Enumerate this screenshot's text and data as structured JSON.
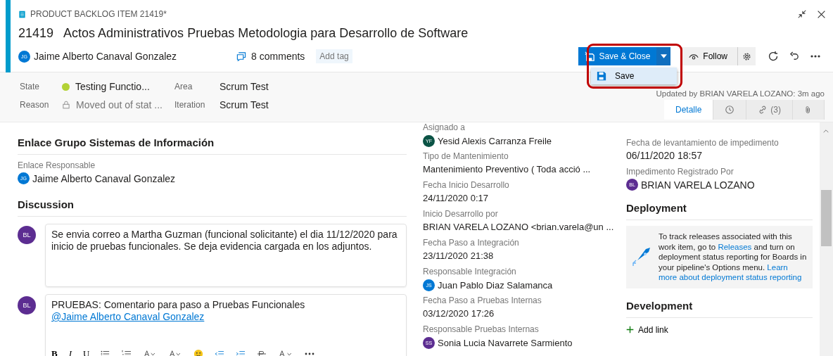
{
  "header": {
    "item_type": "PRODUCT BACKLOG ITEM 21419*",
    "id": "21419",
    "title": "Actos Administrativos Pruebas Metodologia para Desarrollo de Software",
    "assignee": {
      "initials": "JG",
      "name": "Jaime Alberto Canaval Gonzalez",
      "color": "#0078d4"
    },
    "comments": "8 comments",
    "add_tag": "Add tag"
  },
  "toolbar": {
    "save_close": "Save & Close",
    "follow": "Follow",
    "menu": [
      {
        "label": "Save",
        "selected": true
      }
    ]
  },
  "fields": [
    {
      "label": "State",
      "value": "Testing Functio...",
      "kind": "state",
      "color": "#b2d235"
    },
    {
      "label": "Reason",
      "value": "Moved out of stat ...",
      "kind": "locked"
    },
    {
      "label": "Area",
      "value": "Scrum Test",
      "kind": "plain"
    },
    {
      "label": "Iteration",
      "value": "Scrum Test",
      "kind": "plain"
    }
  ],
  "updated": "Updated by BRIAN VARELA LOZANO: 3m ago",
  "tabs": [
    {
      "kind": "text",
      "label": "Detalle",
      "selected": true
    },
    {
      "kind": "history",
      "selected": false
    },
    {
      "kind": "links",
      "label": "(3)",
      "selected": false
    },
    {
      "kind": "attachment",
      "selected": false
    }
  ],
  "left": {
    "section": "Enlace Grupo Sistemas de Información",
    "field_label": "Enlace Responsable",
    "person": {
      "initials": "JG",
      "name": "Jaime Alberto Canaval Gonzalez",
      "color": "#0078d4"
    },
    "discussion": "Discussion",
    "comments": [
      {
        "initials": "BL",
        "color": "#5c2d91",
        "text": "Se envia correo a Martha Guzman (funcional solicitante) el dia 11/12/2020 para inicio de pruebas funcionales. Se deja evidencia cargada en los adjuntos.",
        "kind": "posted"
      },
      {
        "initials": "BL",
        "color": "#5c2d91",
        "text": "PRUEBAS: Comentario para paso a Pruebas Funcionales",
        "mention": "@Jaime Alberto Canaval Gonzalez",
        "kind": "editing"
      }
    ],
    "format": [
      "B",
      "I",
      "U"
    ]
  },
  "middle": [
    {
      "label": "Asignado a",
      "value": "Yesid Alexis Carranza Freile",
      "initials": "YF",
      "color": "#0b5345"
    },
    {
      "label": "Tipo de Mantenimiento",
      "value": "Mantenimiento Preventivo ( Toda acció ..."
    },
    {
      "label": "Fecha Inicio Desarrollo",
      "value": "24/11/2020 0:17"
    },
    {
      "label": "Inicio Desarrollo por",
      "value": "BRIAN VARELA LOZANO <brian.varela@un ..."
    },
    {
      "label": "Fecha Paso a Integración",
      "value": "23/11/2020 21:38"
    },
    {
      "label": "Responsable Integración",
      "value": "Juan Pablo Diaz Salamanca",
      "initials": "JS",
      "color": "#0078d4"
    },
    {
      "label": "Fecha Paso a Pruebas Internas",
      "value": "03/12/2020 17:26"
    },
    {
      "label": "Responsable Pruebas Internas",
      "value": "Sonia Lucia Navarrete Sarmiento",
      "initials": "SS",
      "color": "#5c2d91"
    }
  ],
  "right": {
    "fields": [
      {
        "label": "Fecha de levantamiento de impedimento",
        "value": "06/11/2020 18:57"
      },
      {
        "label": "Impedimento Registrado Por",
        "value": "BRIAN VARELA LOZANO",
        "initials": "BL",
        "color": "#5c2d91"
      }
    ],
    "deployment": "Deployment",
    "deployment_text": [
      {
        "kind": "text",
        "text": "To track releases associated with this work item, go to "
      },
      {
        "kind": "link",
        "text": "Releases"
      },
      {
        "kind": "text",
        "text": " and turn on deployment status reporting for Boards in your pipeline's Options menu. "
      },
      {
        "kind": "link",
        "text": "Learn"
      },
      {
        "kind": "link",
        "text": "more about deployment status reporting"
      }
    ],
    "development": "Development",
    "add_link": "Add link"
  }
}
